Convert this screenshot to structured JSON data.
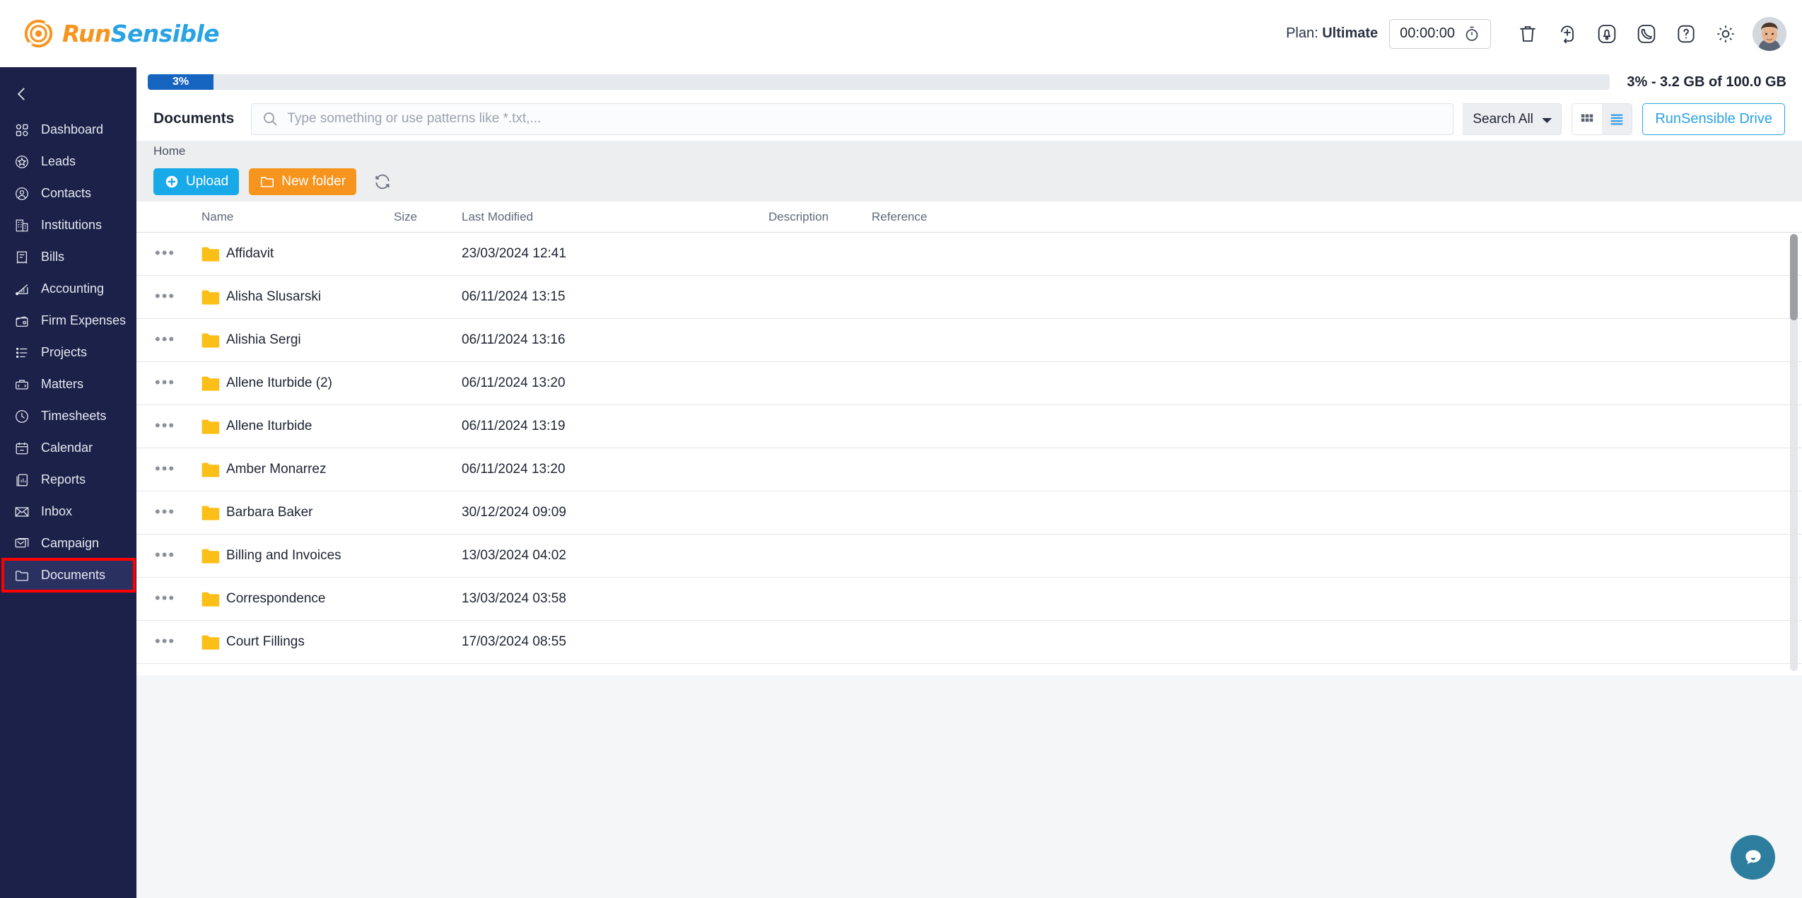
{
  "header": {
    "logo_run": "Run",
    "logo_sensible": "Sensible",
    "plan_label": "Plan:",
    "plan_value": "Ultimate",
    "timer_value": "00:00:00",
    "icons": [
      {
        "name": "trash-icon",
        "label": "Trash"
      },
      {
        "name": "add-new-icon",
        "label": "Add New"
      },
      {
        "name": "notifications-bell-icon",
        "label": "Notifications"
      },
      {
        "name": "phone-call-icon",
        "label": "Calls"
      },
      {
        "name": "help-question-icon",
        "label": "Help"
      },
      {
        "name": "settings-gear-icon",
        "label": "Settings"
      }
    ],
    "avatar_alt": "User avatar"
  },
  "sidebar": {
    "collapse_label": "Collapse",
    "items": [
      {
        "label": "Dashboard",
        "icon": "dashboard-icon"
      },
      {
        "label": "Leads",
        "icon": "leads-star-icon"
      },
      {
        "label": "Contacts",
        "icon": "contacts-person-icon"
      },
      {
        "label": "Institutions",
        "icon": "institutions-building-icon"
      },
      {
        "label": "Bills",
        "icon": "bills-receipt-icon"
      },
      {
        "label": "Accounting",
        "icon": "accounting-chart-icon"
      },
      {
        "label": "Firm Expenses",
        "icon": "firm-expenses-wallet-icon"
      },
      {
        "label": "Projects",
        "icon": "projects-list-icon"
      },
      {
        "label": "Matters",
        "icon": "matters-briefcase-icon"
      },
      {
        "label": "Timesheets",
        "icon": "timesheets-clock-icon"
      },
      {
        "label": "Calendar",
        "icon": "calendar-icon"
      },
      {
        "label": "Reports",
        "icon": "reports-icon"
      },
      {
        "label": "Inbox",
        "icon": "inbox-envelope-icon"
      },
      {
        "label": "Campaign",
        "icon": "campaign-envelopes-icon"
      },
      {
        "label": "Documents",
        "icon": "documents-folder-icon"
      }
    ],
    "active_index": 14,
    "highlight_index": 14
  },
  "storage": {
    "percent_badge": "3%",
    "percent_value": 3,
    "summary": "3% - 3.2 GB of 100.0 GB"
  },
  "toolbar": {
    "title": "Documents",
    "search_placeholder": "Type something or use patterns like *.txt,...",
    "search_value": "",
    "search_icon": "search-icon",
    "scope_selected": "Search All",
    "scope_options": [
      "Search All"
    ],
    "grid_view_icon": "grid-view-icon",
    "list_view_icon": "list-view-icon",
    "active_view": "list",
    "drive_button": "RunSensible Drive"
  },
  "breadcrumb": {
    "items": [
      "Home"
    ]
  },
  "actions": {
    "upload_label": "Upload",
    "upload_icon": "plus-circle-icon",
    "new_folder_label": "New folder",
    "new_folder_icon": "folder-icon",
    "refresh_icon": "refresh-icon"
  },
  "file_table": {
    "columns": [
      "Name",
      "Size",
      "Last Modified",
      "Description",
      "Reference"
    ],
    "row_menu_label": "•••",
    "rows": [
      {
        "name": "Affidavit",
        "size": "",
        "modified": "23/03/2024 12:41",
        "description": "",
        "reference": "",
        "icon": "folder-icon"
      },
      {
        "name": "Alisha Slusarski",
        "size": "",
        "modified": "06/11/2024 13:15",
        "description": "",
        "reference": "",
        "icon": "folder-icon"
      },
      {
        "name": "Alishia Sergi",
        "size": "",
        "modified": "06/11/2024 13:16",
        "description": "",
        "reference": "",
        "icon": "folder-icon"
      },
      {
        "name": "Allene Iturbide (2)",
        "size": "",
        "modified": "06/11/2024 13:20",
        "description": "",
        "reference": "",
        "icon": "folder-icon"
      },
      {
        "name": "Allene Iturbide",
        "size": "",
        "modified": "06/11/2024 13:19",
        "description": "",
        "reference": "",
        "icon": "folder-icon"
      },
      {
        "name": "Amber Monarrez",
        "size": "",
        "modified": "06/11/2024 13:20",
        "description": "",
        "reference": "",
        "icon": "folder-icon"
      },
      {
        "name": "Barbara Baker",
        "size": "",
        "modified": "30/12/2024 09:09",
        "description": "",
        "reference": "",
        "icon": "folder-icon"
      },
      {
        "name": "Billing and Invoices",
        "size": "",
        "modified": "13/03/2024 04:02",
        "description": "",
        "reference": "",
        "icon": "folder-icon"
      },
      {
        "name": "Correspondence",
        "size": "",
        "modified": "13/03/2024 03:58",
        "description": "",
        "reference": "",
        "icon": "folder-icon"
      },
      {
        "name": "Court Fillings",
        "size": "",
        "modified": "17/03/2024 08:55",
        "description": "",
        "reference": "",
        "icon": "folder-icon"
      },
      {
        "name": "",
        "size": "",
        "modified": "",
        "description": "",
        "reference": "",
        "icon": "folder-icon"
      }
    ]
  },
  "chat": {
    "icon": "chat-bubble-icon",
    "label": "Chat"
  },
  "colors": {
    "brand_orange": "#F7941E",
    "brand_blue": "#29A3E3",
    "sidebar_navy": "#1b2148",
    "sidebar_active": "#2a3160",
    "highlight_red": "#ff0000",
    "progress_blue": "#1565C0",
    "folder_yellow": "#FCBF17",
    "chat_teal": "#2D7E9E"
  }
}
